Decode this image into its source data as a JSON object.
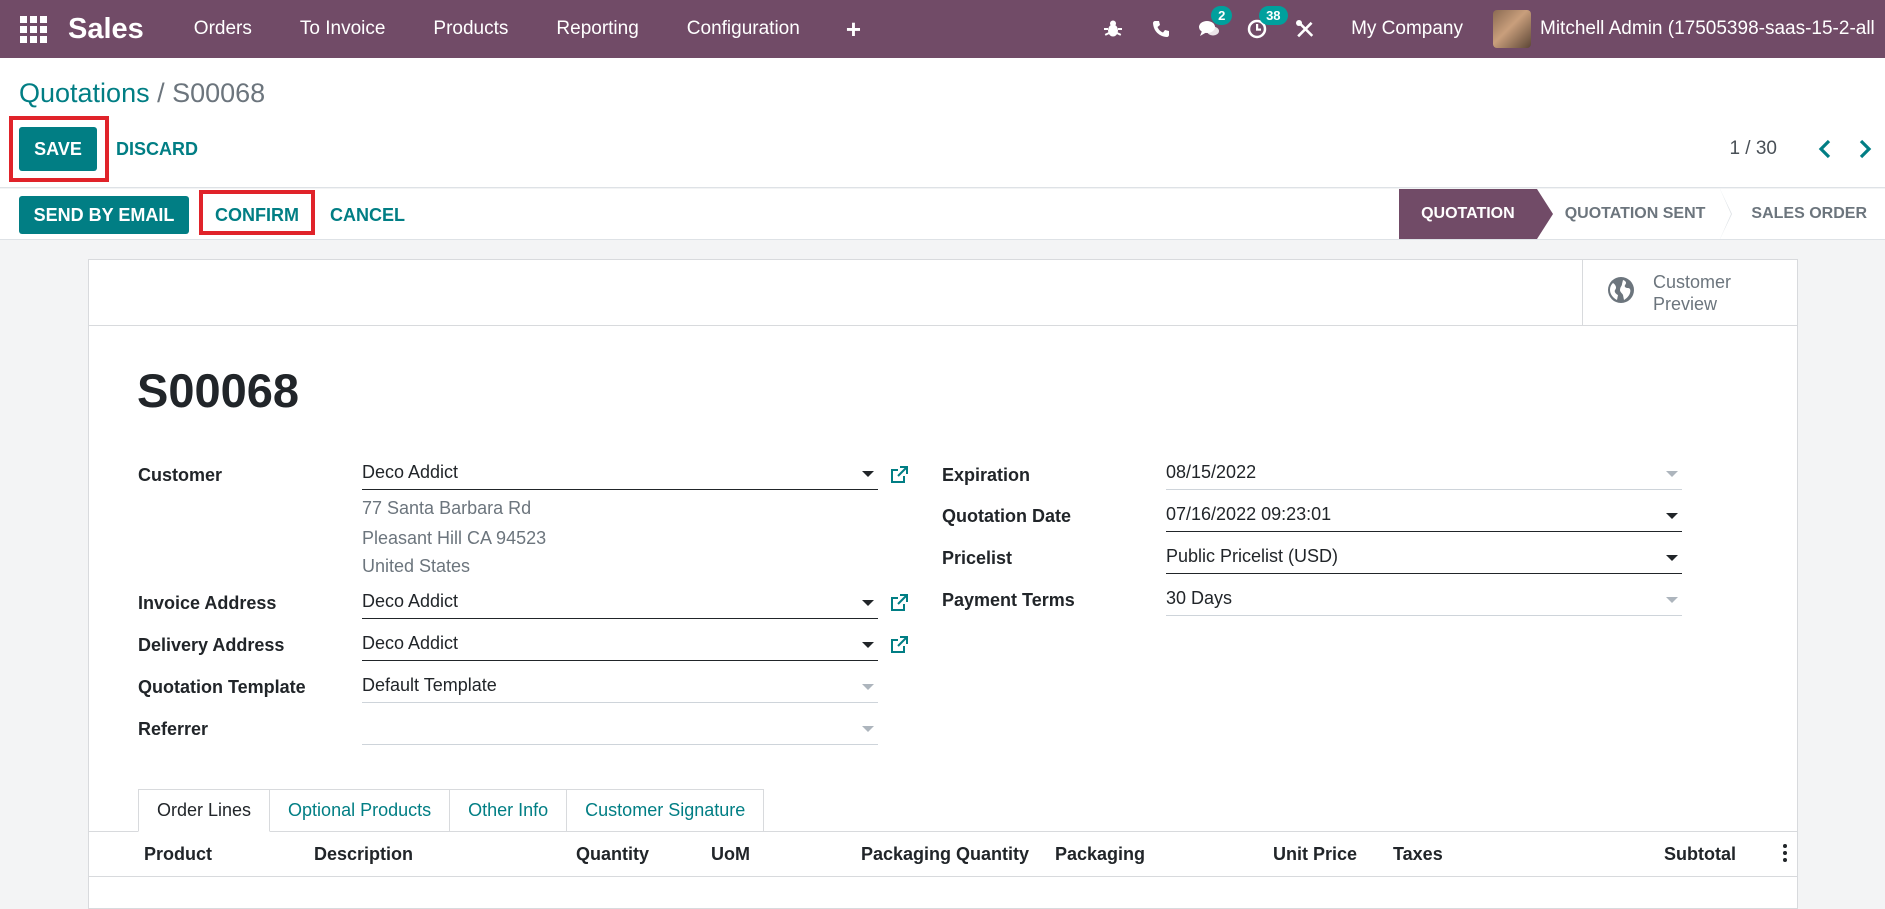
{
  "navbar": {
    "app_name": "Sales",
    "menu": [
      "Orders",
      "To Invoice",
      "Products",
      "Reporting",
      "Configuration"
    ],
    "plus": "+",
    "messages_count": "2",
    "activities_count": "38",
    "company": "My Company",
    "user": "Mitchell Admin (17505398-saas-15-2-all"
  },
  "breadcrumb": {
    "parent": "Quotations",
    "separator": " / ",
    "current": "S00068"
  },
  "actions": {
    "save": "SAVE",
    "discard": "DISCARD"
  },
  "pager": {
    "value": "1 / 30"
  },
  "statusbar": {
    "send_email": "SEND BY EMAIL",
    "confirm": "CONFIRM",
    "cancel": "CANCEL",
    "stages": [
      "QUOTATION",
      "QUOTATION SENT",
      "SALES ORDER"
    ]
  },
  "smart_button": {
    "line1": "Customer",
    "line2": "Preview"
  },
  "record": {
    "name": "S00068"
  },
  "form": {
    "customer_label": "Customer",
    "customer": "Deco Addict",
    "address": [
      "77 Santa Barbara Rd",
      "Pleasant Hill CA 94523",
      "United States"
    ],
    "invoice_label": "Invoice Address",
    "invoice": "Deco Addict",
    "delivery_label": "Delivery Address",
    "delivery": "Deco Addict",
    "template_label": "Quotation Template",
    "template": "Default Template",
    "referrer_label": "Referrer",
    "referrer": "",
    "expiration_label": "Expiration",
    "expiration": "08/15/2022",
    "qdate_label": "Quotation Date",
    "qdate": "07/16/2022 09:23:01",
    "pricelist_label": "Pricelist",
    "pricelist": "Public Pricelist (USD)",
    "terms_label": "Payment Terms",
    "terms": "30 Days"
  },
  "tabs": [
    "Order Lines",
    "Optional Products",
    "Other Info",
    "Customer Signature"
  ],
  "columns": [
    "Product",
    "Description",
    "Quantity",
    "UoM",
    "Packaging Quantity",
    "Packaging",
    "Unit Price",
    "Taxes",
    "Subtotal"
  ],
  "colors": {
    "navbar": "#714b67",
    "primary": "#017e84",
    "highlight": "#e0232a"
  }
}
